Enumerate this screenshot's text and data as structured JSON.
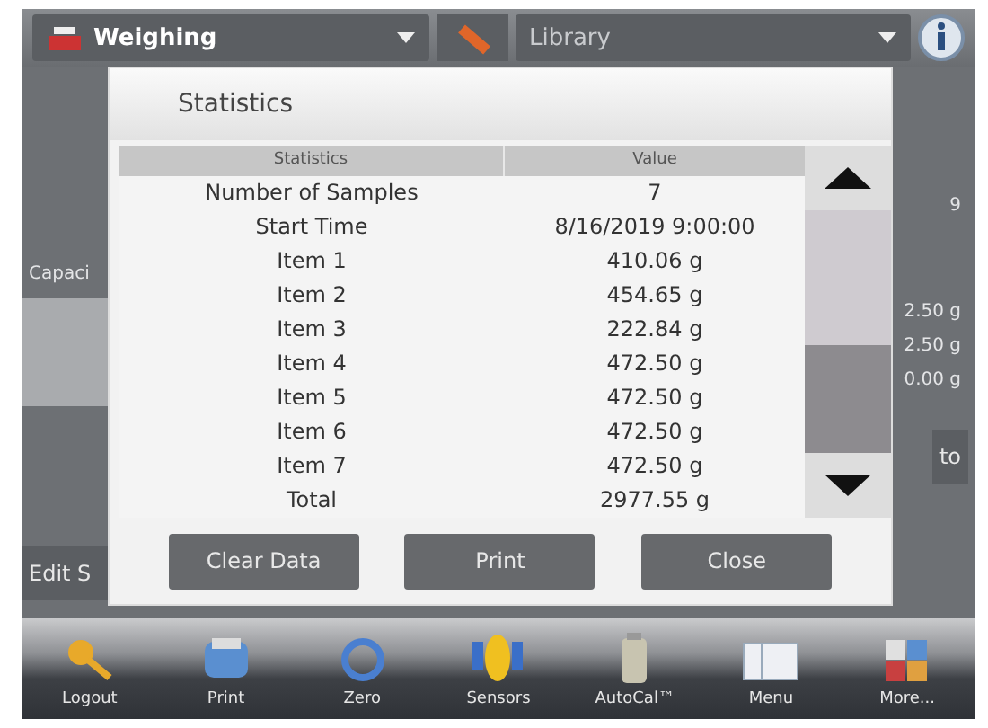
{
  "top_bar": {
    "app_selector": "Weighing",
    "library_selector": "Library"
  },
  "background": {
    "left_label": "Capaci",
    "left_button": "Edit S",
    "right_reading": "9",
    "right_values": [
      "2.50 g",
      "2.50 g",
      "0.00 g"
    ],
    "right_button": "to"
  },
  "dialog": {
    "title": "Statistics",
    "columns": [
      "Statistics",
      "Value"
    ],
    "rows": [
      [
        "Number of Samples",
        "7"
      ],
      [
        "Start Time",
        "8/16/2019 9:00:00"
      ],
      [
        "Item 1",
        "410.06 g"
      ],
      [
        "Item 2",
        "454.65 g"
      ],
      [
        "Item 3",
        "222.84 g"
      ],
      [
        "Item 4",
        "472.50 g"
      ],
      [
        "Item 5",
        "472.50 g"
      ],
      [
        "Item 6",
        "472.50 g"
      ],
      [
        "Item 7",
        "472.50 g"
      ],
      [
        "Total",
        "2977.55 g"
      ]
    ],
    "buttons": [
      "Clear Data",
      "Print",
      "Close"
    ]
  },
  "toolbar": [
    {
      "label": "Logout",
      "kind": "key"
    },
    {
      "label": "Print",
      "kind": "printer"
    },
    {
      "label": "Zero",
      "kind": "zero"
    },
    {
      "label": "Sensors",
      "kind": "sensor"
    },
    {
      "label": "AutoCal™",
      "kind": "weight"
    },
    {
      "label": "Menu",
      "kind": "menu"
    },
    {
      "label": "More...",
      "kind": "more"
    }
  ]
}
